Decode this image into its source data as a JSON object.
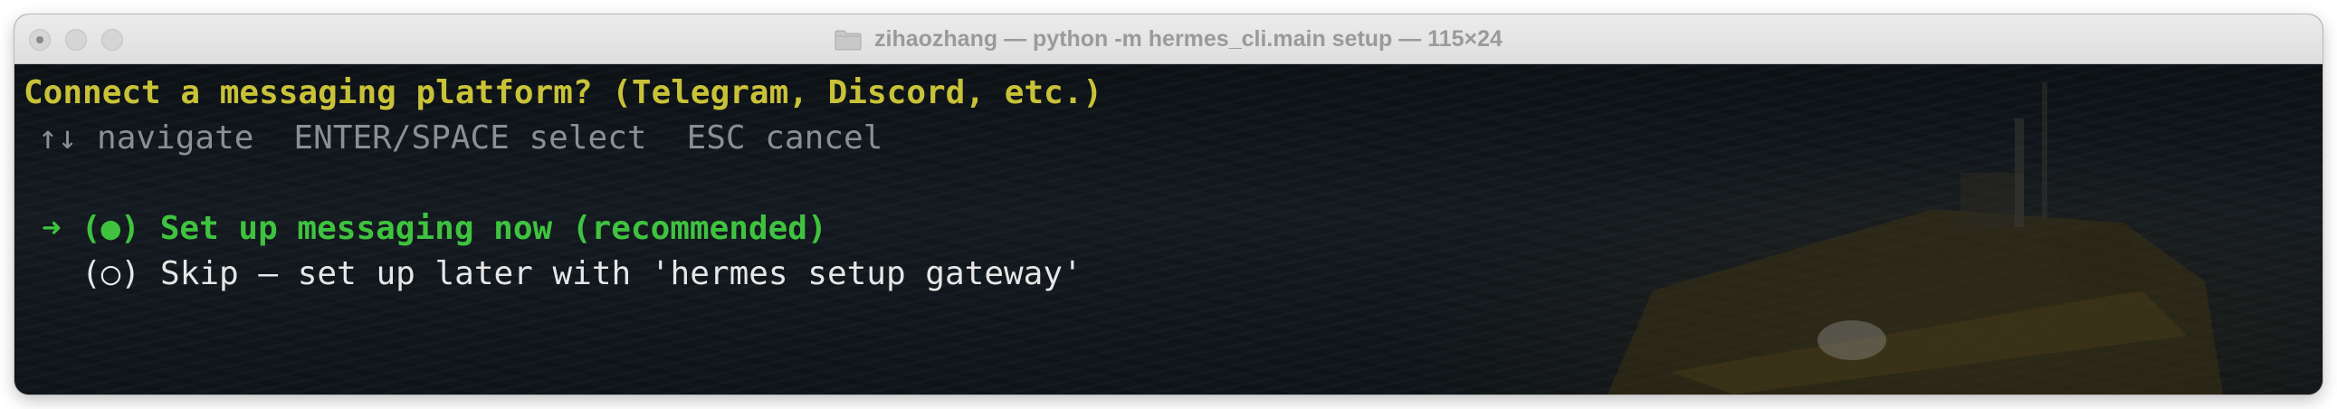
{
  "window": {
    "title": "zihaozhang — python -m hermes_cli.main setup — 115×24",
    "title_icon": "folder-icon"
  },
  "terminal": {
    "question": "Connect a messaging platform? (Telegram, Discord, etc.)",
    "hints": {
      "navigate": "↑↓ navigate",
      "select": "ENTER/SPACE select",
      "cancel": "ESC cancel"
    },
    "options": [
      {
        "cursor": "➜",
        "marker": "(●)",
        "label": "Set up messaging now (recommended)",
        "selected": true
      },
      {
        "cursor": "",
        "marker": "(○)",
        "label": "Skip — set up later with 'hermes setup gateway'",
        "selected": false
      }
    ]
  },
  "colors": {
    "question": "#c9c238",
    "hint": "#8b8f94",
    "selected_option": "#3fc33f",
    "option": "#e6e6e6"
  }
}
